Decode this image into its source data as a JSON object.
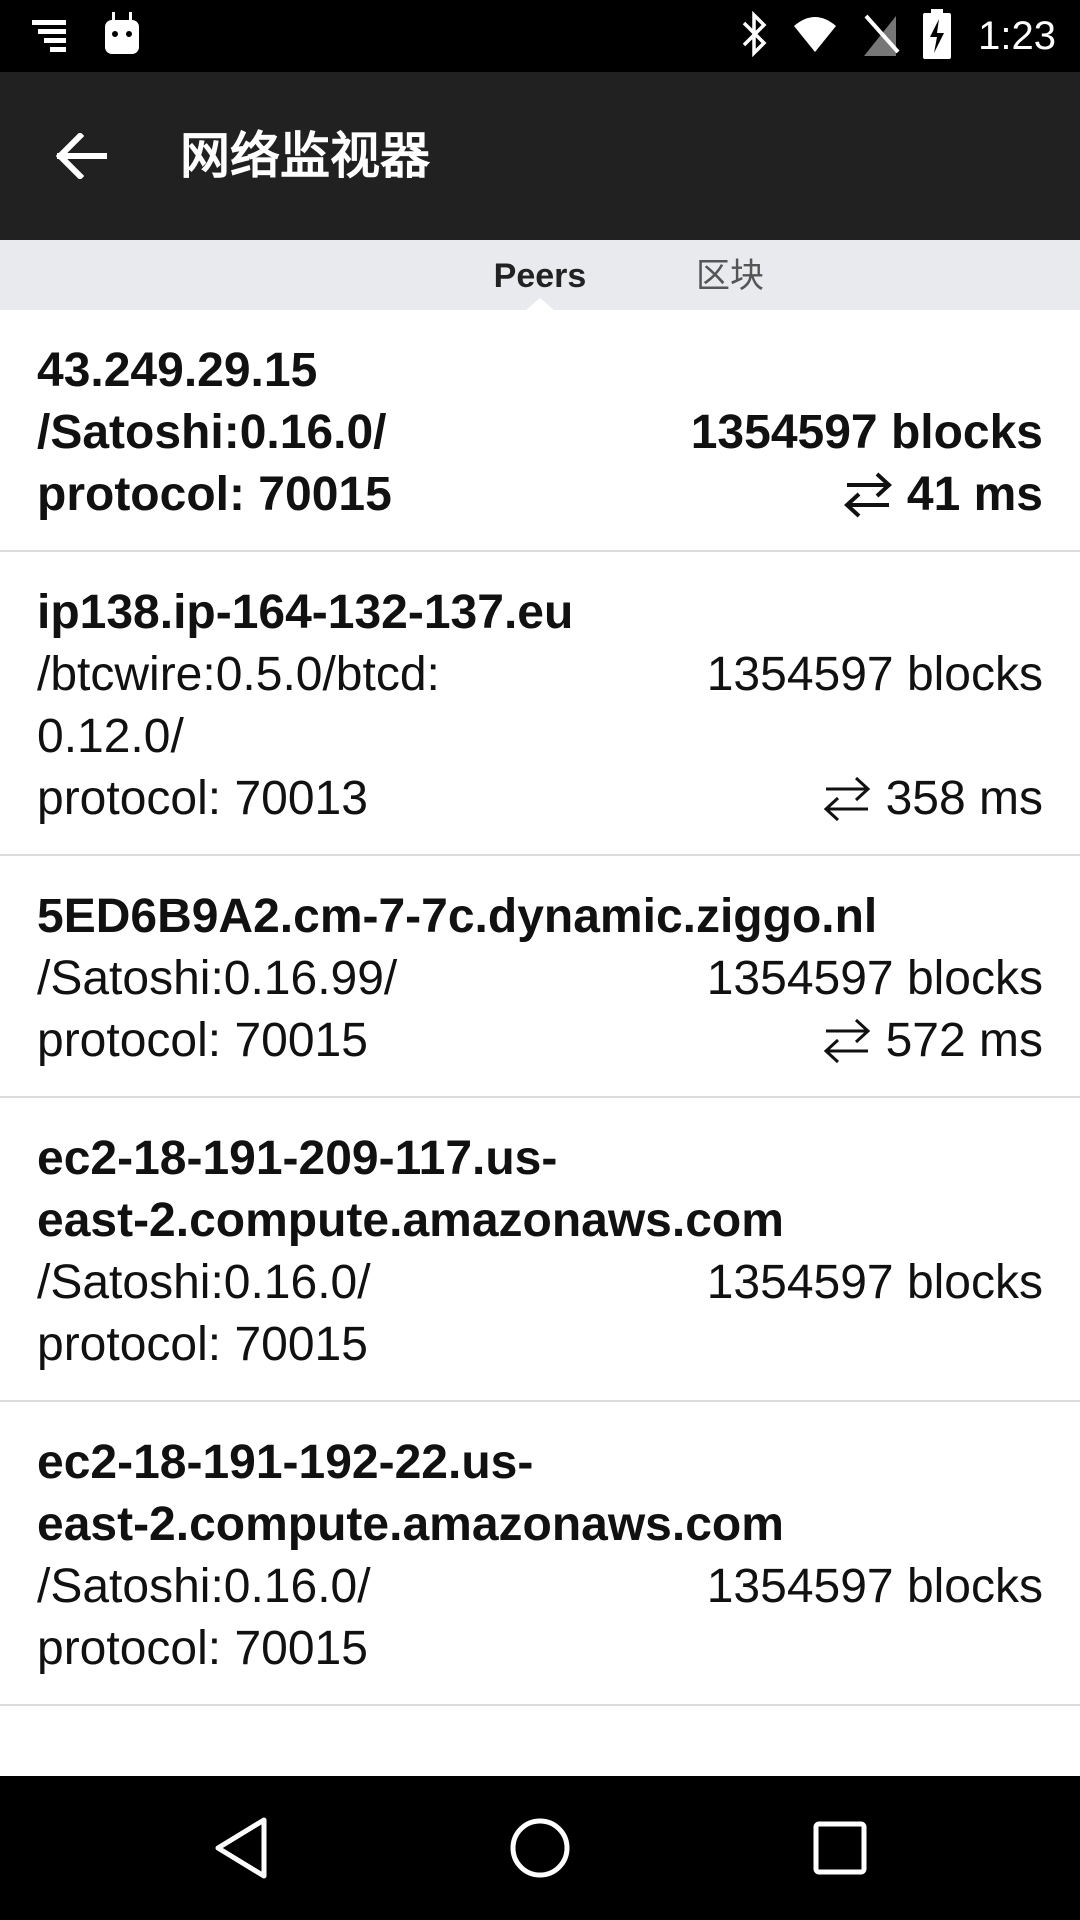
{
  "status_bar": {
    "time": "1:23",
    "icons": [
      "notification-list-icon",
      "android-icon",
      "bluetooth-icon",
      "wifi-icon",
      "no-sim-icon",
      "battery-charging-icon"
    ]
  },
  "toolbar": {
    "back_icon": "arrow-back-icon",
    "title": "网络监视器"
  },
  "tabs": [
    {
      "label": "Peers",
      "selected": true
    },
    {
      "label": "区块",
      "selected": false
    }
  ],
  "peers": [
    {
      "host": "43.249.29.15",
      "version": "/Satoshi:0.16.0/",
      "blocks": "1354597 blocks",
      "protocol": "protocol: 70015",
      "ping": "41 ms",
      "bold": true
    },
    {
      "host": "ip138.ip-164-132-137.eu",
      "version": "/btcwire:0.5.0/btcd:\n0.12.0/",
      "blocks": "1354597 blocks",
      "protocol": "protocol: 70013",
      "ping": "358 ms",
      "bold": false
    },
    {
      "host": "5ED6B9A2.cm-7-7c.dynamic.ziggo.nl",
      "version": "/Satoshi:0.16.99/",
      "blocks": "1354597 blocks",
      "protocol": "protocol: 70015",
      "ping": "572 ms",
      "bold": false
    },
    {
      "host": "ec2-18-191-209-117.us-\neast-2.compute.amazonaws.com",
      "version": "/Satoshi:0.16.0/",
      "blocks": "1354597 blocks",
      "protocol": "protocol: 70015",
      "ping": "",
      "bold": false
    },
    {
      "host": "ec2-18-191-192-22.us-\neast-2.compute.amazonaws.com",
      "version": "/Satoshi:0.16.0/",
      "blocks": "1354597 blocks",
      "protocol": "protocol: 70015",
      "ping": "",
      "bold": false
    }
  ],
  "nav_bar": {
    "icons": [
      "back-triangle-icon",
      "home-circle-icon",
      "recents-square-icon"
    ]
  }
}
